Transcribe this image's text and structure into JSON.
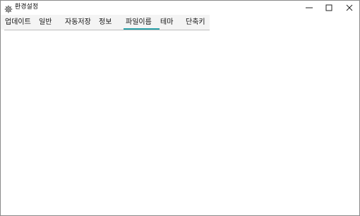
{
  "window": {
    "title": "환경설정",
    "icon": "gear-icon"
  },
  "window_controls": {
    "minimize_icon": "minimize-icon",
    "maximize_icon": "maximize-icon",
    "close_icon": "close-icon"
  },
  "tabs": [
    {
      "label": "업데이트"
    },
    {
      "label": "일반"
    },
    {
      "label": "자동저장"
    },
    {
      "label": "정보"
    },
    {
      "label": "파일이름",
      "selected": true
    },
    {
      "label": "테마"
    },
    {
      "label": "단축키"
    }
  ],
  "colors": {
    "accent": "#2aa1a8",
    "tabbar_background": "#f4f4f4"
  }
}
